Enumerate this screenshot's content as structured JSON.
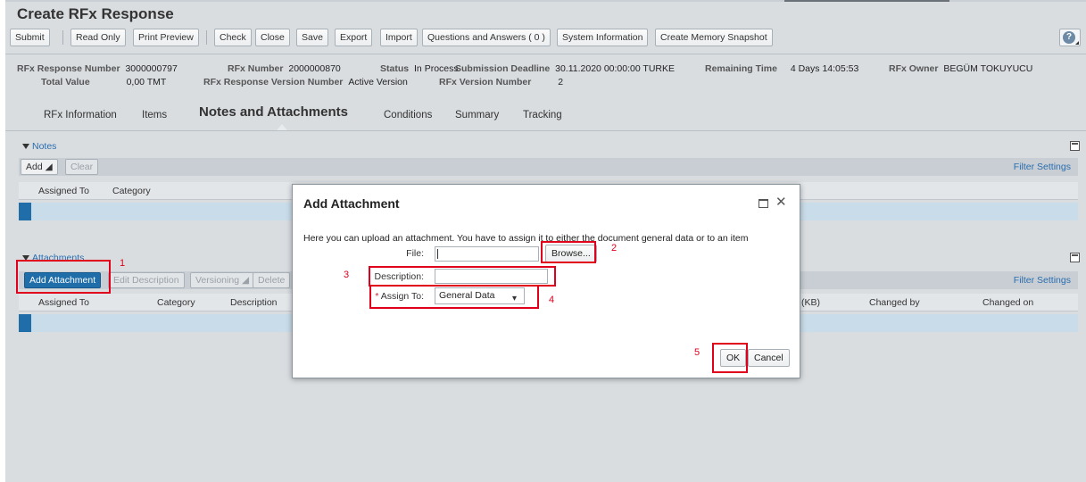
{
  "page": {
    "title": "Create RFx Response"
  },
  "toolbar": {
    "submit": "Submit",
    "read_only": "Read Only",
    "print_preview": "Print Preview",
    "check": "Check",
    "close": "Close",
    "save": "Save",
    "export": "Export",
    "import": "Import",
    "qa": "Questions and Answers ( 0 )",
    "system_info": "System Information",
    "memory_snapshot": "Create Memory Snapshot",
    "help_icon": "question-circle-icon"
  },
  "header": {
    "response_number_label": "RFx Response Number",
    "response_number": "3000000797",
    "total_value_label": "Total Value",
    "total_value": "0,00 TMT",
    "rfx_number_label": "RFx Number",
    "rfx_number": "2000000870",
    "response_version_label": "RFx Response Version Number",
    "response_version": "Active Version",
    "status_label": "Status",
    "status": "In Process",
    "rfx_version_label": "RFx Version Number",
    "rfx_version": "2",
    "deadline_label": "Submission Deadline",
    "deadline": "30.11.2020 00:00:00 TURKE",
    "remaining_label": "Remaining Time",
    "remaining": "4 Days 14:05:53",
    "owner_label": "RFx Owner",
    "owner": "BEGÜM TOKUYUCU"
  },
  "tabs": [
    "RFx Information",
    "Items",
    "Notes and Attachments",
    "Conditions",
    "Summary",
    "Tracking"
  ],
  "notes": {
    "title": "Notes",
    "add": "Add",
    "clear": "Clear",
    "filter": "Filter Settings",
    "columns": [
      "Assigned To",
      "Category"
    ]
  },
  "attachments": {
    "title": "Attachments",
    "add_attachment": "Add Attachment",
    "edit_description": "Edit Description",
    "versioning": "Versioning",
    "delete": "Delete",
    "filter": "Filter Settings",
    "columns": [
      "Assigned To",
      "Category",
      "Description",
      "(KB)",
      "Changed by",
      "Changed on"
    ]
  },
  "dialog": {
    "title": "Add Attachment",
    "description_text": "Here you can upload an attachment. You have to assign it to either the document general data or to an item",
    "file_label": "File:",
    "file_value": "",
    "browse": "Browse...",
    "description_label": "Description:",
    "description_value": "",
    "assign_label": "Assign To:",
    "assign_value": "General Data",
    "ok": "OK",
    "cancel": "Cancel"
  },
  "annotations": [
    "1",
    "2",
    "3",
    "4",
    "5"
  ],
  "colors": {
    "accent": "#1f6ea9",
    "annotation": "#e0001b",
    "link": "#2a6eb0"
  }
}
